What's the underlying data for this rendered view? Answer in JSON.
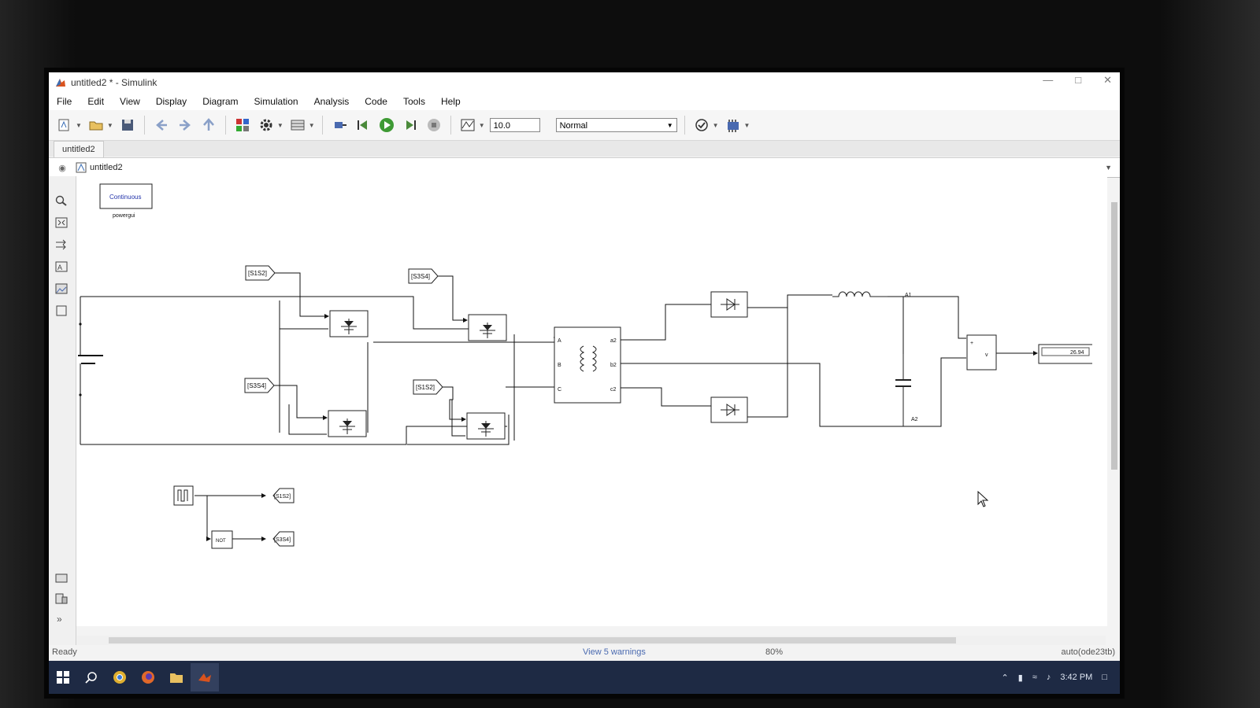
{
  "window": {
    "title": "untitled2 * - Simulink"
  },
  "menu": [
    "File",
    "Edit",
    "View",
    "Display",
    "Diagram",
    "Simulation",
    "Analysis",
    "Code",
    "Tools",
    "Help"
  ],
  "toolbar": {
    "stop_time": "10.0",
    "sim_mode": "Normal"
  },
  "tabs": [
    "untitled2"
  ],
  "breadcrumb": "untitled2",
  "model": {
    "powergui_mode": "Continuous",
    "powergui_name": "powergui",
    "goto_tags": [
      "[S1S2]",
      "[S3S4]",
      "[S3S4]",
      "[S1S2]",
      "[S1S2]",
      "[S3S4]"
    ],
    "not_label": "NOT",
    "display_value": "26.94",
    "port_labels": {
      "A": "A",
      "B": "B",
      "C": "C",
      "a2": "a2",
      "b2": "b2",
      "c2": "c2",
      "A1": "A1",
      "A2": "A2"
    }
  },
  "status": {
    "state": "Ready",
    "warnings": "View 5 warnings",
    "zoom": "80%",
    "solver": "auto(ode23tb)"
  },
  "taskbar": {
    "time": "3:42 PM"
  }
}
